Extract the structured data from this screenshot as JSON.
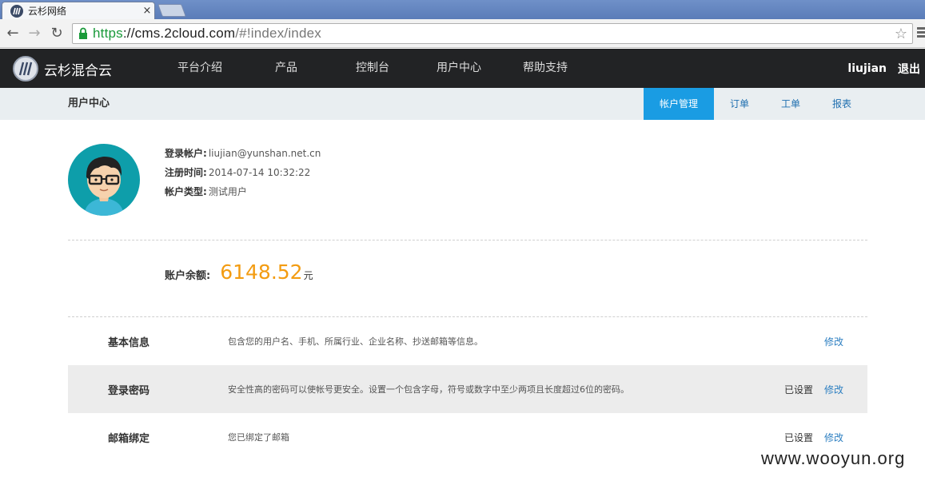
{
  "browser": {
    "tab_title": "云杉网络",
    "tab_close": "×",
    "url_scheme": "https",
    "url_host": "://cms.2cloud.com",
    "url_path": "/#!index/index",
    "back": "←",
    "forward": "→",
    "reload": "↻",
    "star": "☆"
  },
  "site": {
    "brand": "云杉混合云",
    "nav": [
      "平台介绍",
      "产品",
      "控制台",
      "用户中心",
      "帮助支持"
    ],
    "username": "liujian",
    "logout": "退出"
  },
  "subnav": {
    "title": "用户中心",
    "tabs": [
      "帐户管理",
      "订单",
      "工单",
      "报表"
    ]
  },
  "profile": {
    "rows": [
      {
        "key": "登录帐户:",
        "value": "liujian@yunshan.net.cn"
      },
      {
        "key": "注册时间:",
        "value": "2014-07-14 10:32:22"
      },
      {
        "key": "帐户类型:",
        "value": "测试用户"
      }
    ],
    "balance_label": "账户余额:",
    "balance_amount": "6148.52",
    "balance_unit": "元"
  },
  "settings": [
    {
      "name": "基本信息",
      "desc": "包含您的用户名、手机、所属行业、企业名称、抄送邮箱等信息。",
      "state": "",
      "edit": "修改"
    },
    {
      "name": "登录密码",
      "desc": "安全性高的密码可以使帐号更安全。设置一个包含字母，符号或数字中至少两项且长度超过6位的密码。",
      "state": "已设置",
      "edit": "修改"
    },
    {
      "name": "邮箱绑定",
      "desc": "您已绑定了邮箱",
      "state": "已设置",
      "edit": "修改"
    }
  ],
  "watermark": "www.wooyun.org",
  "colors": {
    "accent": "#1a9ce3",
    "balance": "#f39c12",
    "header_bg": "#222325",
    "subnav_bg": "#e9eef1",
    "link": "#2d7fc1"
  }
}
